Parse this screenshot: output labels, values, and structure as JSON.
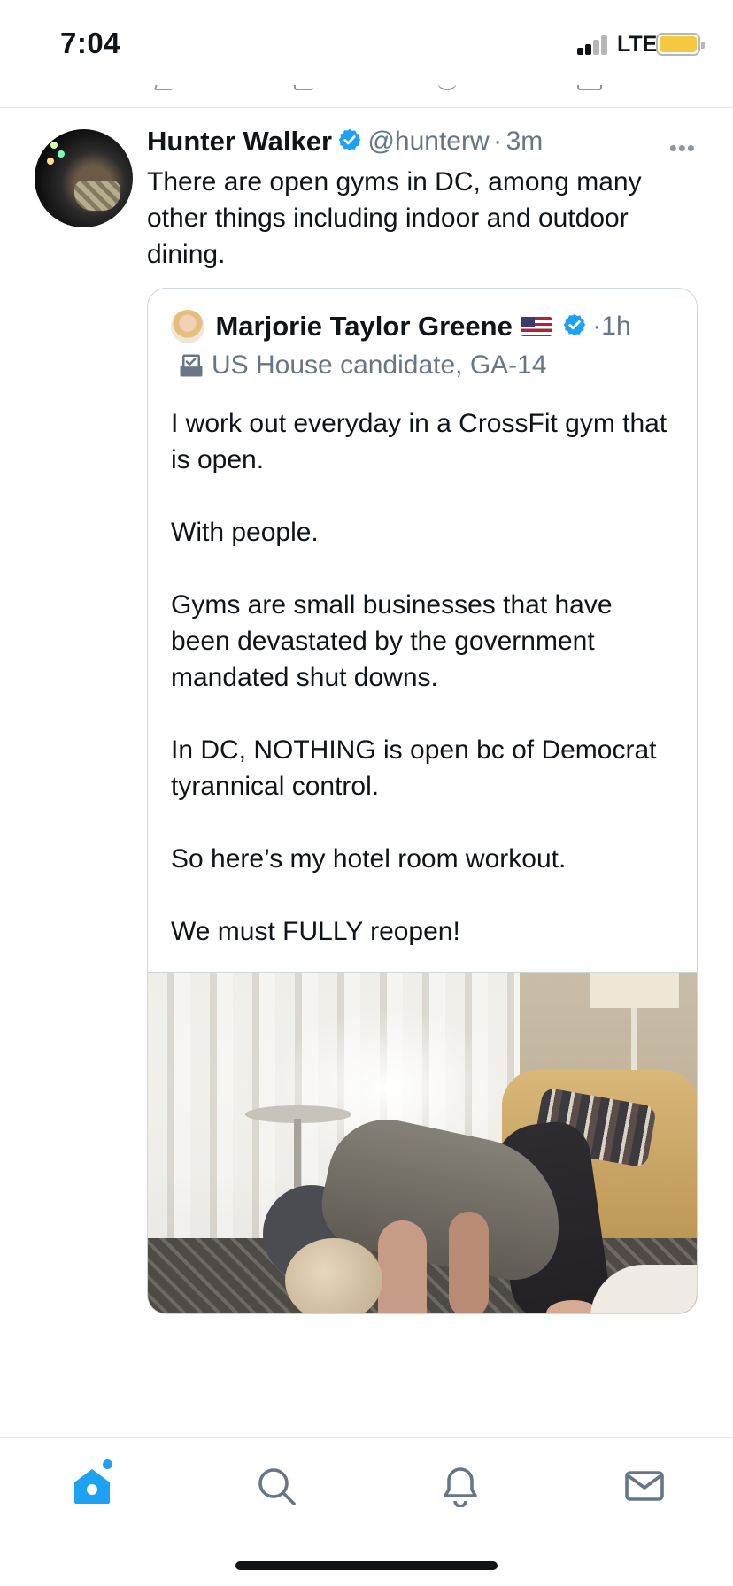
{
  "status_bar": {
    "time": "7:04",
    "network": "LTE",
    "battery_color": "#f5c842"
  },
  "tweet": {
    "author_name": "Hunter Walker",
    "handle": "@hunterw",
    "separator": "·",
    "time": "3m",
    "more_icon": "more-dots-icon",
    "text": "There are open gyms in DC, among many other things including indoor and outdoor dining."
  },
  "quote": {
    "author_name": "Marjorie Taylor Greene",
    "flag_icon": "us-flag-emoji",
    "separator": "·",
    "time": "1h",
    "label": "US House candidate, GA-14",
    "label_icon": "ballot-box-icon",
    "paragraphs": [
      "I work out everyday in a CrossFit gym that is open.",
      "With people.",
      "Gyms are small businesses that have been devastated by the government mandated shut downs.",
      "In DC, NOTHING is open bc of Democrat tyrannical control.",
      "So here’s my hotel room workout.",
      "We must FULLY reopen!"
    ],
    "media_icon": "video-thumbnail"
  },
  "tab_bar": {
    "tabs": [
      {
        "icon": "home-icon",
        "active": true,
        "has_badge": true
      },
      {
        "icon": "search-icon",
        "active": false
      },
      {
        "icon": "bell-icon",
        "active": false
      },
      {
        "icon": "mail-icon",
        "active": false
      }
    ],
    "accent_color": "#1da1f2",
    "inactive_color": "#657786"
  }
}
